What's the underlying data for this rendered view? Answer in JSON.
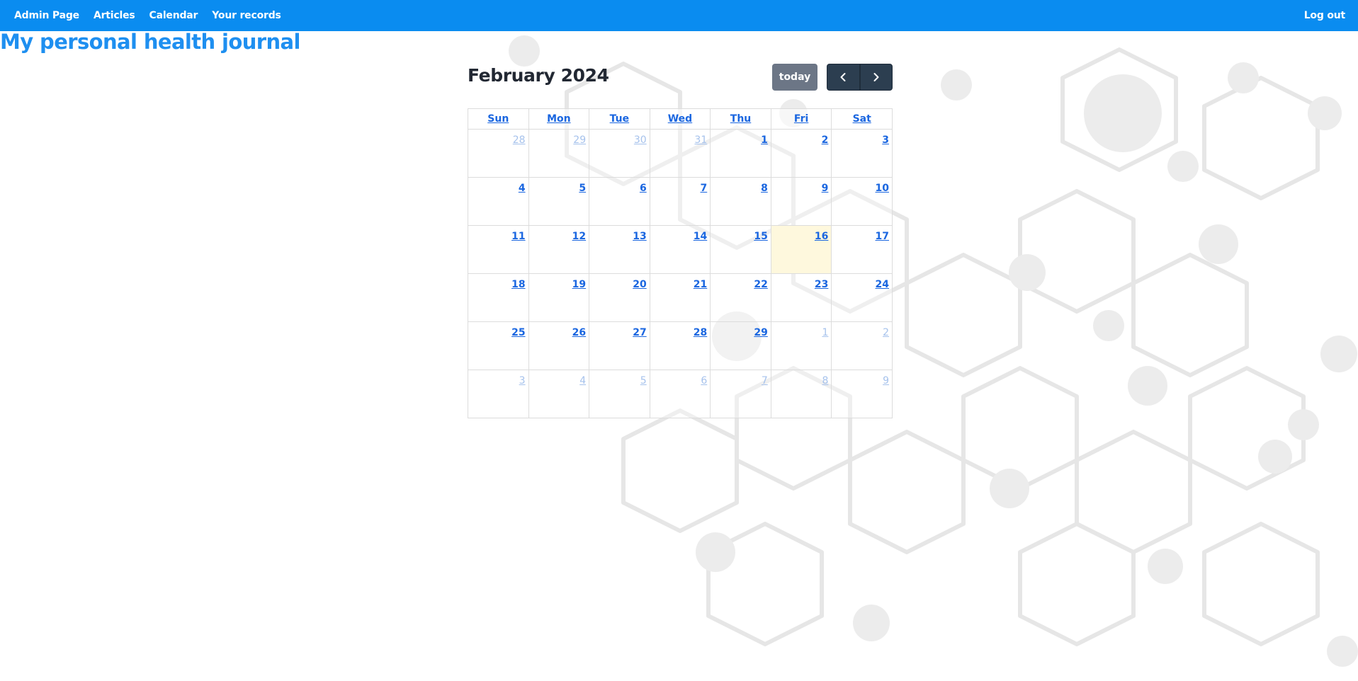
{
  "nav": {
    "links": [
      "Admin Page",
      "Articles",
      "Calendar",
      "Your records"
    ],
    "logout_label": "Log out"
  },
  "page_title": "My personal health journal",
  "calendar": {
    "title": "February 2024",
    "today_label": "today",
    "prev_icon": "chevron-left-icon",
    "next_icon": "chevron-right-icon",
    "weekdays": [
      "Sun",
      "Mon",
      "Tue",
      "Wed",
      "Thu",
      "Fri",
      "Sat"
    ],
    "weeks": [
      [
        "28",
        "29",
        "30",
        "31",
        "1",
        "2",
        "3"
      ],
      [
        "4",
        "5",
        "6",
        "7",
        "8",
        "9",
        "10"
      ],
      [
        "11",
        "12",
        "13",
        "14",
        "15",
        "16",
        "17"
      ],
      [
        "18",
        "19",
        "20",
        "21",
        "22",
        "23",
        "24"
      ],
      [
        "25",
        "26",
        "27",
        "28",
        "29",
        "1",
        "2"
      ],
      [
        "3",
        "4",
        "5",
        "6",
        "7",
        "8",
        "9"
      ]
    ],
    "today_day": "16"
  },
  "colors": {
    "navbar": "#0a8cf0",
    "title": "#1e8ff0",
    "day_link": "#1a66e0",
    "other_month": "#a6c2ec",
    "today_cell": "#fef8dd",
    "today_button": "#6c7686",
    "arrow_button": "#2c3e50"
  }
}
